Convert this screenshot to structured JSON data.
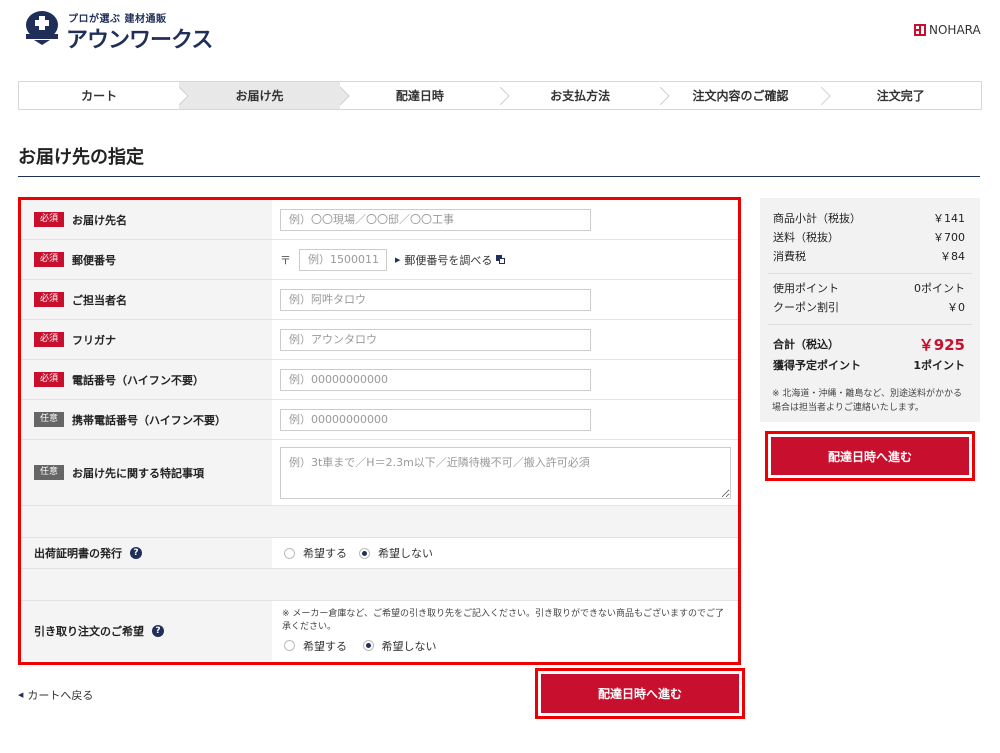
{
  "header": {
    "logo_sub": "プロが選ぶ 建材通販",
    "logo_main": "アウンワークス",
    "partner": "NOHARA"
  },
  "steps": [
    "カート",
    "お届け先",
    "配達日時",
    "お支払方法",
    "注文内容のご確認",
    "注文完了"
  ],
  "page_title": "お届け先の指定",
  "form": {
    "required_badge": "必須",
    "optional_badge": "任意",
    "recipient": {
      "label": "お届け先名",
      "placeholder": "例）〇〇現場／〇〇邸／〇〇工事"
    },
    "postal": {
      "label": "郵便番号",
      "prefix": "〒",
      "placeholder": "例）1500011",
      "lookup_link": "郵便番号を調べる"
    },
    "contact_person": {
      "label": "ご担当者名",
      "placeholder": "例）阿吽タロウ"
    },
    "furigana": {
      "label": "フリガナ",
      "placeholder": "例）アウンタロウ"
    },
    "phone": {
      "label": "電話番号（ハイフン不要）",
      "placeholder": "例）00000000000"
    },
    "mobile": {
      "label": "携帯電話番号（ハイフン不要）",
      "placeholder": "例）00000000000"
    },
    "notes": {
      "label": "お届け先に関する特記事項",
      "placeholder": "例）3t車まで／H＝2.3m以下／近隣待機不可／搬入許可必須"
    },
    "shipping_cert": {
      "label": "出荷証明書の発行",
      "options": [
        "希望する",
        "希望しない"
      ],
      "selected": "希望しない"
    },
    "pickup": {
      "label": "引き取り注文のご希望",
      "note": "※ メーカー倉庫など、ご希望の引き取り先をご記入ください。引き取りができない商品もございますのでご了承ください。",
      "options": [
        "希望する",
        "希望しない"
      ],
      "selected": "希望しない"
    }
  },
  "summary": {
    "subtotal_label": "商品小計（税抜）",
    "subtotal": "￥141",
    "shipping_label": "送料（税抜）",
    "shipping": "￥700",
    "tax_label": "消費税",
    "tax": "￥84",
    "points_used_label": "使用ポイント",
    "points_used": "0ポイント",
    "coupon_label": "クーポン割引",
    "coupon": "￥0",
    "total_label": "合計（税込）",
    "total": "￥925",
    "earned_label": "獲得予定ポイント",
    "earned": "1ポイント",
    "note": "※ 北海道・沖縄・離島など、別途送料がかかる場合は担当者よりご連絡いたします。"
  },
  "buttons": {
    "next": "配達日時へ進む",
    "back": "カートへ戻る"
  },
  "colors": {
    "accent": "#c8102e",
    "navy": "#1f2f58",
    "highlight": "#ee0000"
  }
}
